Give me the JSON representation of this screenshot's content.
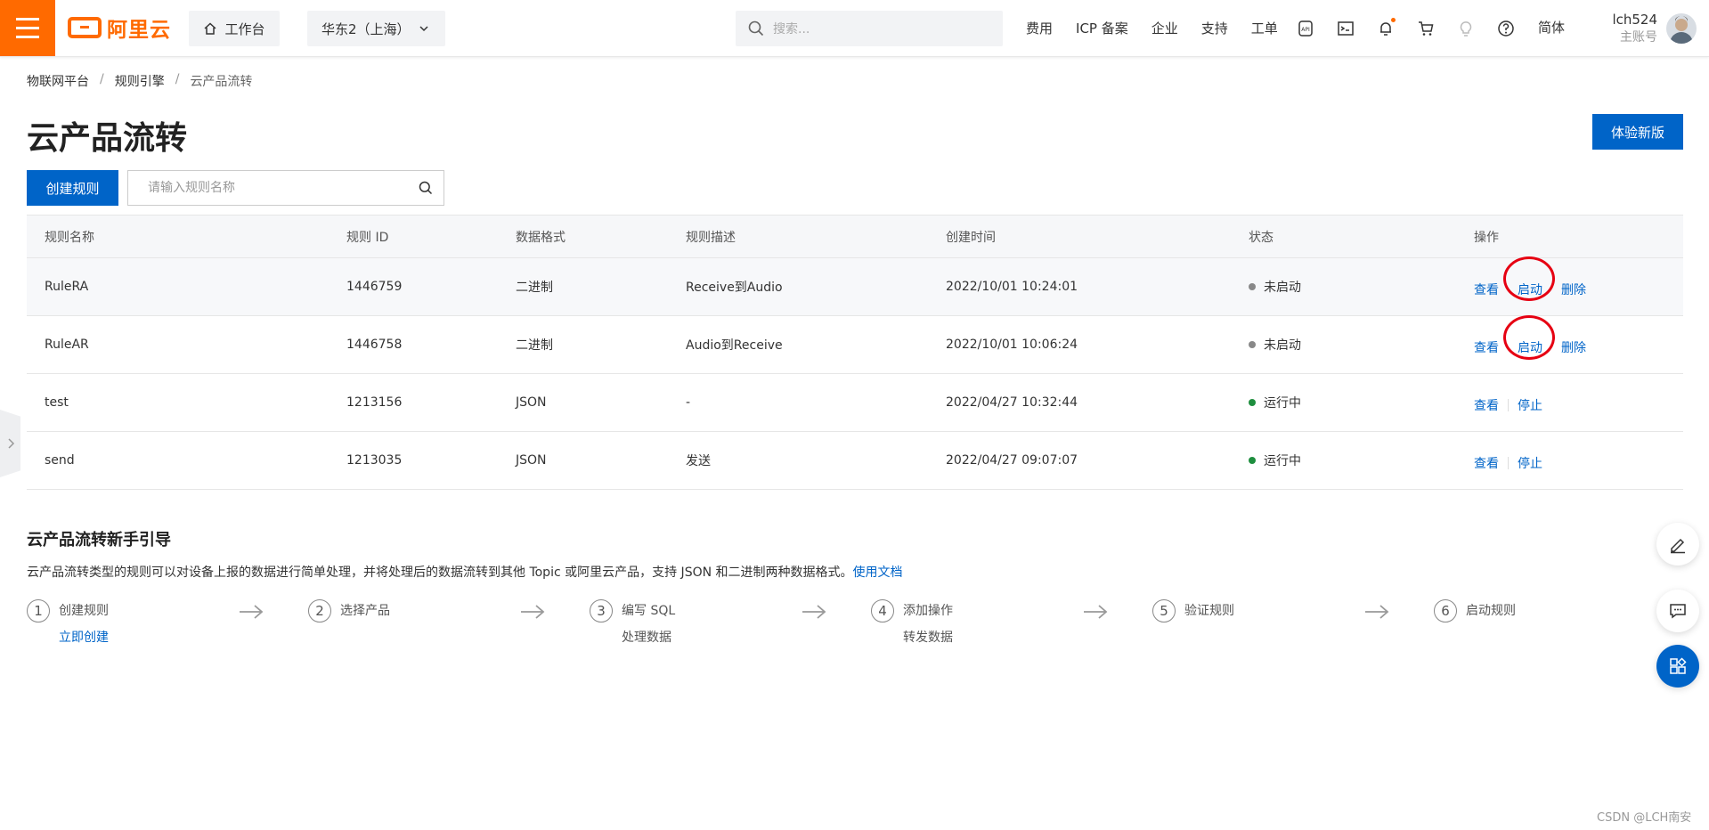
{
  "topbar": {
    "logo_text": "阿里云",
    "workbench": "工作台",
    "region": "华东2（上海）",
    "search_placeholder": "搜索...",
    "nav_links": [
      "费用",
      "ICP 备案",
      "企业",
      "支持",
      "工单"
    ],
    "nav_icons": [
      "api-icon",
      "terminal-icon",
      "bell-icon",
      "cart-icon",
      "lightbulb-icon",
      "help-icon"
    ],
    "language": "简体",
    "user_name": "lch524",
    "user_role": "主账号"
  },
  "breadcrumb": [
    "物联网平台",
    "规则引擎",
    "云产品流转"
  ],
  "page_title": "云产品流转",
  "try_new_label": "体验新版",
  "create_label": "创建规则",
  "name_search_placeholder": "请输入规则名称",
  "table": {
    "headers": [
      "规则名称",
      "规则 ID",
      "数据格式",
      "规则描述",
      "创建时间",
      "状态",
      "操作"
    ],
    "rows": [
      {
        "name": "RuleRA",
        "id": "1446759",
        "format": "二进制",
        "desc": "Receive到Audio",
        "time": "2022/10/01 10:24:01",
        "status": "未启动",
        "ops": [
          "查看",
          "启动",
          "删除"
        ]
      },
      {
        "name": "RuleAR",
        "id": "1446758",
        "format": "二进制",
        "desc": "Audio到Receive",
        "time": "2022/10/01 10:06:24",
        "status": "未启动",
        "ops": [
          "查看",
          "启动",
          "删除"
        ]
      },
      {
        "name": "test",
        "id": "1213156",
        "format": "JSON",
        "desc": "-",
        "time": "2022/04/27 10:32:44",
        "status": "运行中",
        "ops": [
          "查看",
          "停止"
        ]
      },
      {
        "name": "send",
        "id": "1213035",
        "format": "JSON",
        "desc": "发送",
        "time": "2022/04/27 09:07:07",
        "status": "运行中",
        "ops": [
          "查看",
          "停止"
        ]
      }
    ]
  },
  "guide": {
    "title": "云产品流转新手引导",
    "desc": "云产品流转类型的规则可以对设备上报的数据进行简单处理，并将处理后的数据流转到其他 Topic 或阿里云产品，支持 JSON 和二进制两种数据格式。",
    "doc_link": "使用文档",
    "steps": [
      {
        "num": "1",
        "line1": "创建规则",
        "line2": "立即创建"
      },
      {
        "num": "2",
        "line1": "选择产品",
        "line2": ""
      },
      {
        "num": "3",
        "line1": "编写 SQL",
        "line2": "处理数据"
      },
      {
        "num": "4",
        "line1": "添加操作",
        "line2": "转发数据"
      },
      {
        "num": "5",
        "line1": "验证规则",
        "line2": ""
      },
      {
        "num": "6",
        "line1": "启动规则",
        "line2": ""
      }
    ]
  },
  "colors": {
    "brand": "#ff6a00",
    "primary": "#0064c8",
    "status_running": "#1e8e3e",
    "status_stopped": "#888888",
    "annotation": "#e60012"
  },
  "watermark": "CSDN @LCH南安"
}
